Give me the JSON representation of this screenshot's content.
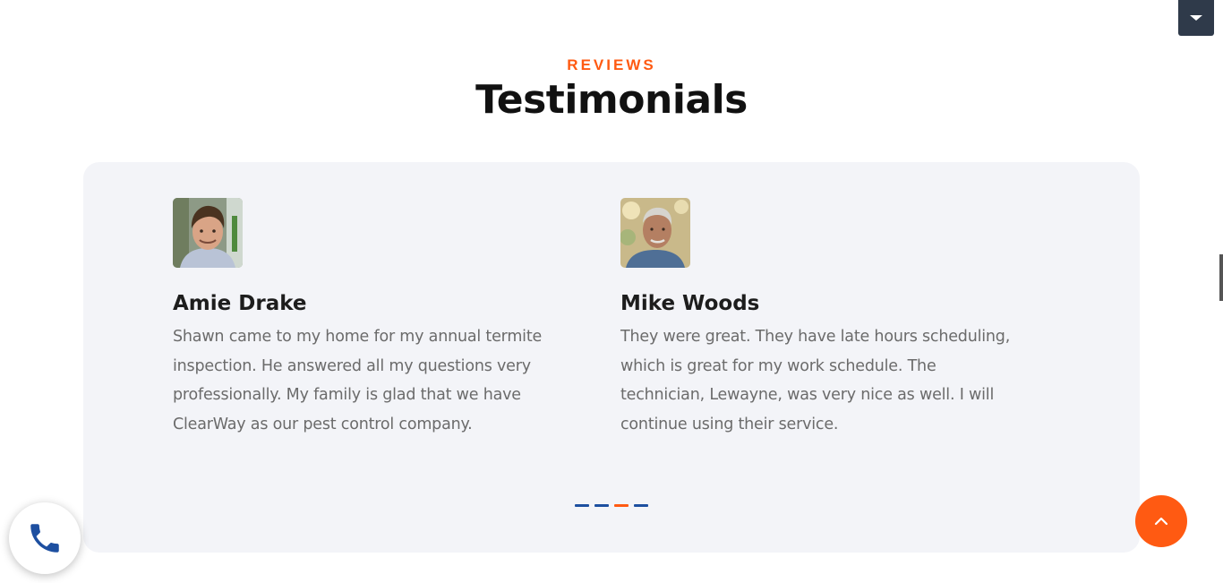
{
  "header": {
    "eyebrow": "REVIEWS",
    "title": "Testimonials"
  },
  "reviews": [
    {
      "name": "Amie Drake",
      "text": "Shawn came to my home for my annual termite inspection. He answered all my questions very professionally. My family is glad that we have ClearWay as our pest control company."
    },
    {
      "name": "Mike Woods",
      "text": "They were great. They have late hours scheduling, which is great for my work schedule. The technician, Lewayne, was very nice as well. I will continue using their service."
    }
  ],
  "carousel": {
    "slide_count": 4,
    "active_index": 2
  },
  "icons": {
    "top_toggle": "caret-down-icon",
    "call": "phone-icon",
    "back_to_top": "chevron-up-icon"
  },
  "colors": {
    "accent": "#ff5a12",
    "brand_blue": "#1d4fa0",
    "card_background": "#f3f4f8",
    "toggle_background": "#2f3a4a"
  }
}
